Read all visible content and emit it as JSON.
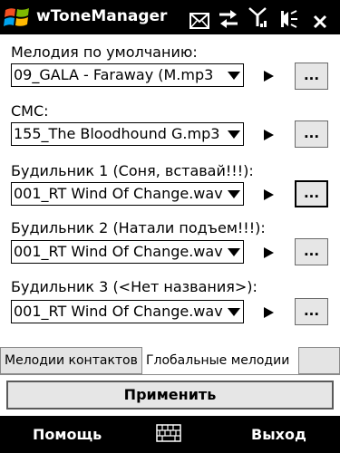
{
  "window": {
    "title": "wToneManager"
  },
  "status_icons": [
    "envelope-icon",
    "sync-arrows-icon",
    "signal-icon",
    "speaker-icon",
    "close-icon"
  ],
  "settings": [
    {
      "label": "Мелодия по умолчанию:",
      "value": "09_GALA - Faraway (M.mp3",
      "browse_label": "..."
    },
    {
      "label": "СМС:",
      "value": "155_The Bloodhound G.mp3",
      "browse_label": "..."
    },
    {
      "label": "Будильник 1 (Соня, вставай!!!):",
      "value": "001_RT Wind Of Change.wav",
      "browse_label": "..."
    },
    {
      "label": "Будильник 2 (Натали подъем!!!):",
      "value": "001_RT Wind Of Change.wav",
      "browse_label": "..."
    },
    {
      "label": "Будильник 3 (<Нет названия>):",
      "value": "001_RT Wind Of Change.wav",
      "browse_label": "..."
    }
  ],
  "tabs": [
    {
      "label": "Мелодии контактов",
      "selected": false
    },
    {
      "label": "Глобальные мелодии",
      "selected": true
    }
  ],
  "apply_button": "Применить",
  "softkeys": {
    "left": "Помощь",
    "right": "Выход"
  },
  "colors": {
    "bar": "#000000",
    "button_face": "#e6e6e6"
  }
}
